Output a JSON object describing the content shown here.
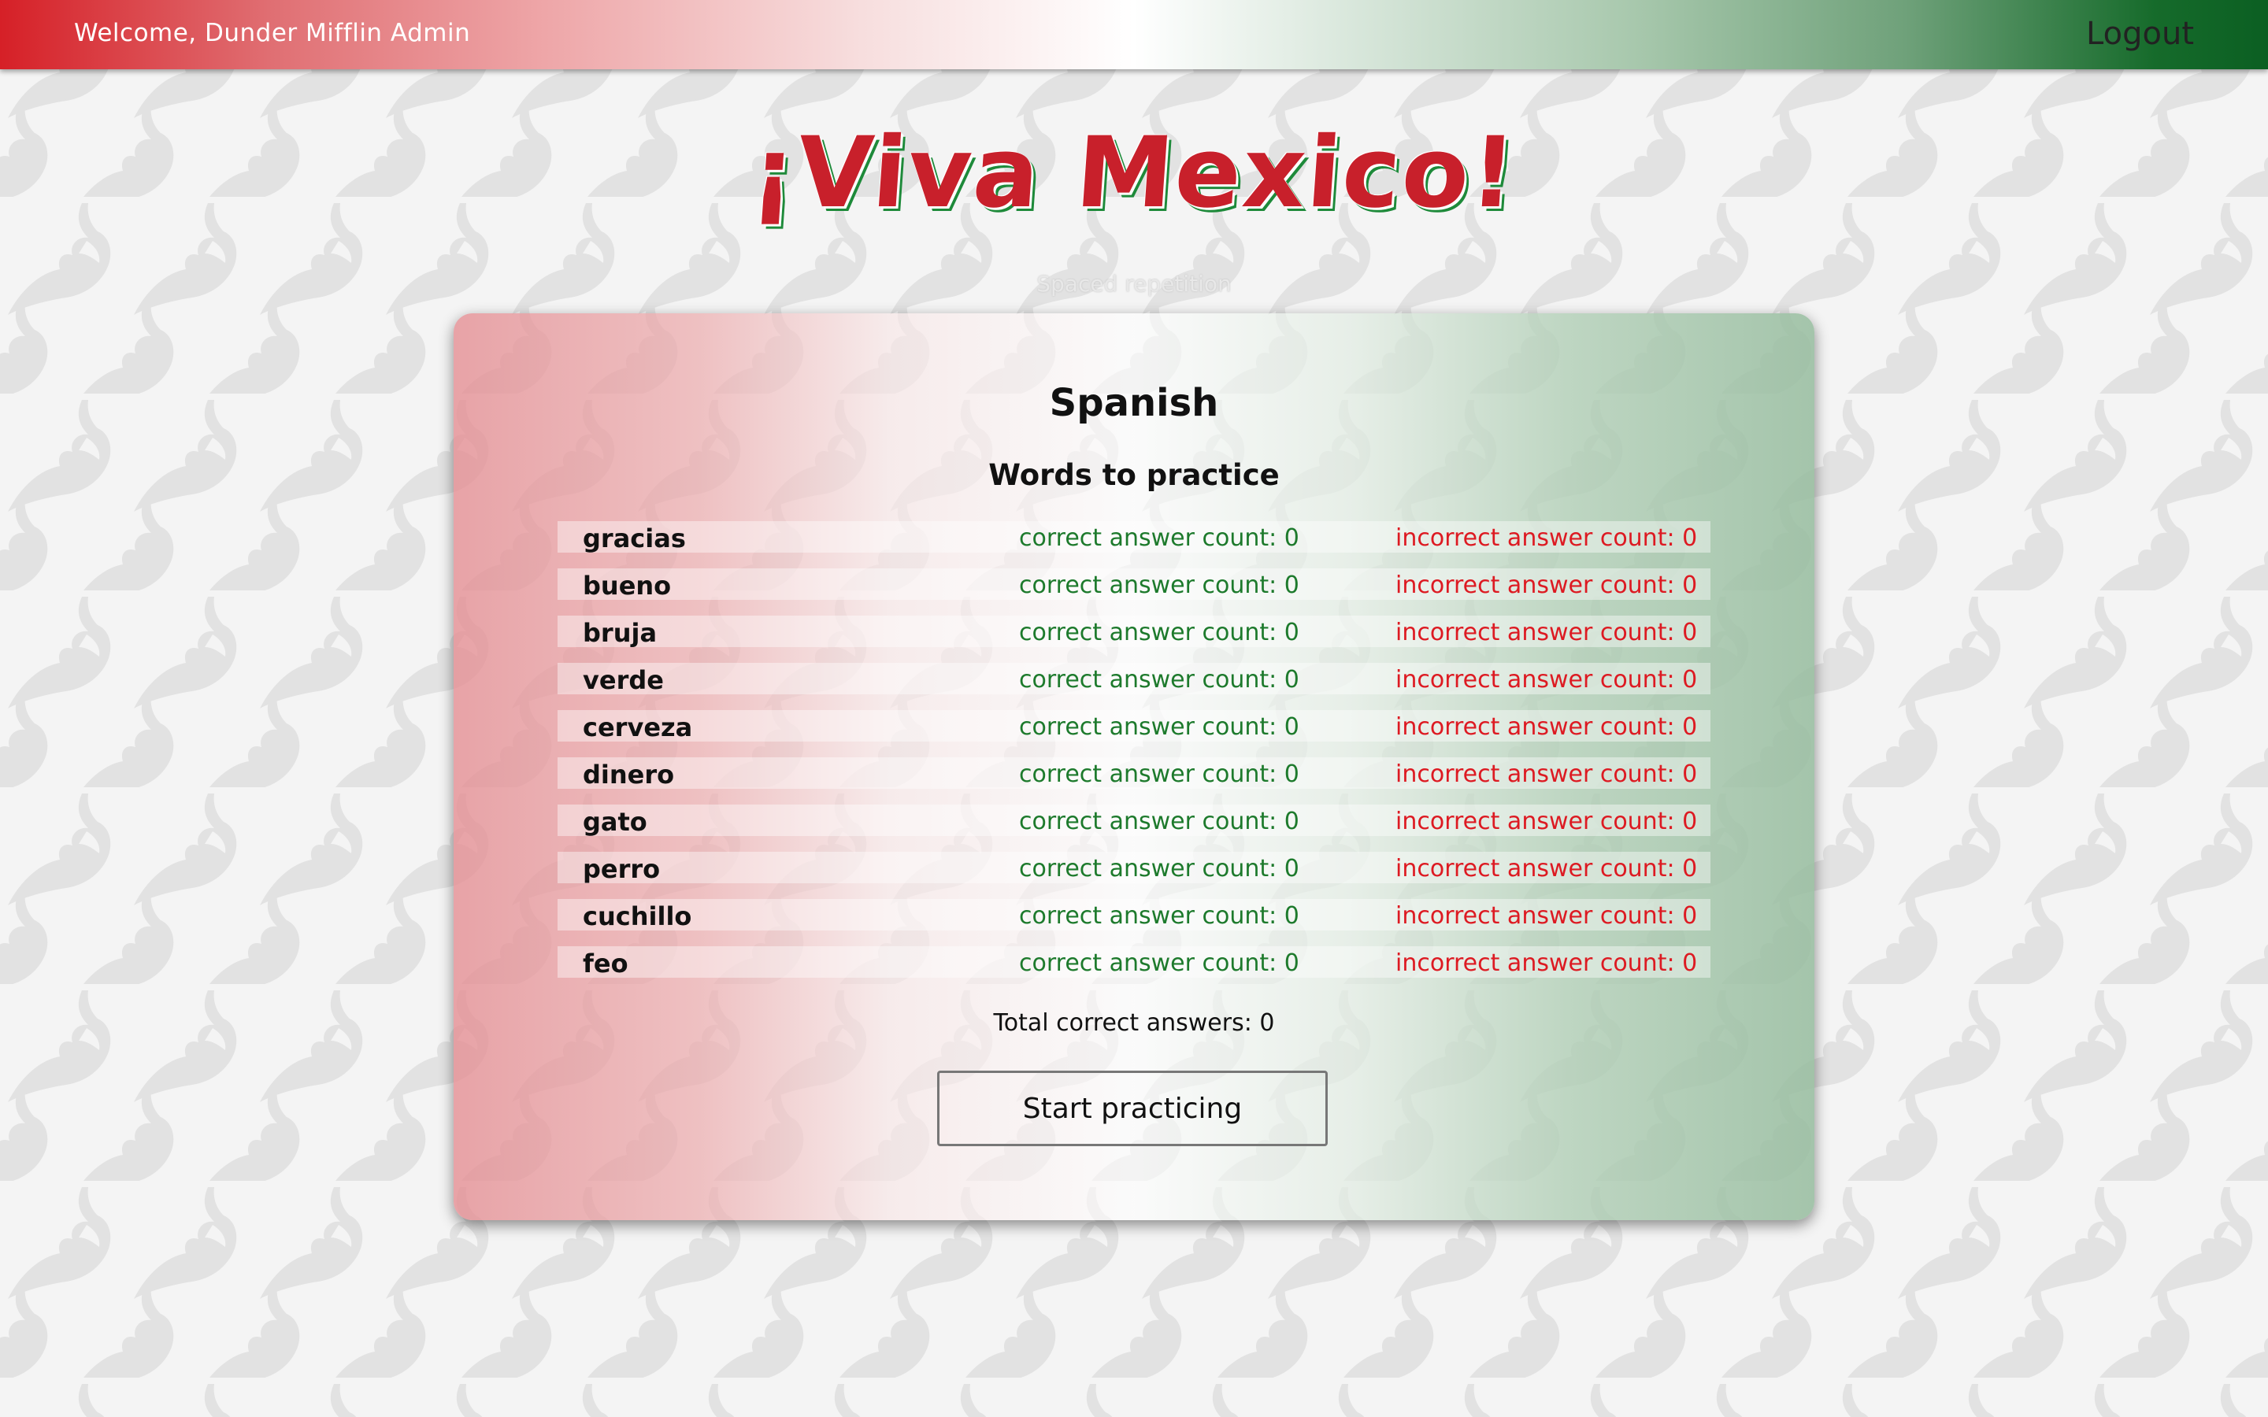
{
  "header": {
    "welcome_text": "Welcome, Dunder Mifflin Admin",
    "logout_label": "Logout"
  },
  "site": {
    "title": "¡Viva Mexico!",
    "subtitle": "Spaced repetition"
  },
  "language": {
    "name": "Spanish",
    "section_title": "Words to practice",
    "words": [
      {
        "word": "gracias",
        "correct": "correct answer count: 0",
        "incorrect": "incorrect answer count: 0"
      },
      {
        "word": "bueno",
        "correct": "correct answer count: 0",
        "incorrect": "incorrect answer count: 0"
      },
      {
        "word": "bruja",
        "correct": "correct answer count: 0",
        "incorrect": "incorrect answer count: 0"
      },
      {
        "word": "verde",
        "correct": "correct answer count: 0",
        "incorrect": "incorrect answer count: 0"
      },
      {
        "word": "cerveza",
        "correct": "correct answer count: 0",
        "incorrect": "incorrect answer count: 0"
      },
      {
        "word": "dinero",
        "correct": "correct answer count: 0",
        "incorrect": "incorrect answer count: 0"
      },
      {
        "word": "gato",
        "correct": "correct answer count: 0",
        "incorrect": "incorrect answer count: 0"
      },
      {
        "word": "perro",
        "correct": "correct answer count: 0",
        "incorrect": "incorrect answer count: 0"
      },
      {
        "word": "cuchillo",
        "correct": "correct answer count: 0",
        "incorrect": "incorrect answer count: 0"
      },
      {
        "word": "feo",
        "correct": "correct answer count: 0",
        "incorrect": "incorrect answer count: 0"
      }
    ],
    "total_text": "Total correct answers: 0",
    "start_button_label": "Start practicing"
  },
  "colors": {
    "flag_red": "#d62027",
    "flag_green": "#0b5f22",
    "correct_text": "#1d7a2c",
    "incorrect_text": "#dd1a22",
    "title_red": "#c8202b",
    "pepper_pattern": "#e3e3e3"
  },
  "icons": {
    "background": "chili-pepper-icon"
  }
}
